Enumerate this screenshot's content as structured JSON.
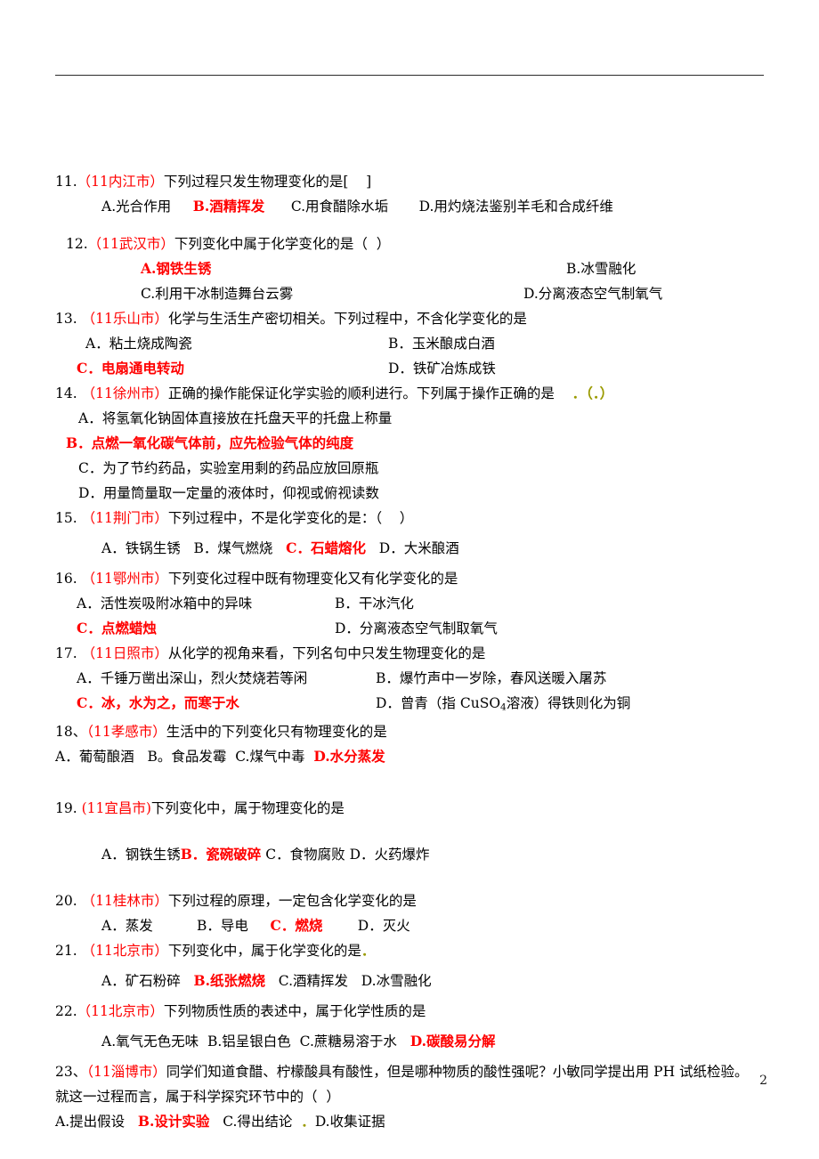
{
  "document": {
    "page_number": "2",
    "accent_red": "#ff0000",
    "marker_olive": "#9a9a00"
  },
  "questions": [
    {
      "id": "q11",
      "number": "11.",
      "source": "（11内江市）",
      "stem": "下列过程只发生物理变化的是[    ]",
      "options_line": {
        "a": "A.光合作用",
        "b": "B.酒精挥发",
        "c": "C.用食醋除水垢",
        "d": "D.用灼烧法鉴别羊毛和合成纤维"
      },
      "answer": "B"
    },
    {
      "id": "q12",
      "number": "12.",
      "source": "（11武汉市）",
      "stem": "下列变化中属于化学变化的是（  ）",
      "options": {
        "a": "A.钢铁生锈",
        "b": "B.冰雪融化",
        "c": "C.利用干冰制造舞台云雾",
        "d": "D.分离液态空气制氧气"
      },
      "answer": "A"
    },
    {
      "id": "q13",
      "number": "13.",
      "source": "（11乐山市）",
      "stem": "化学与生活生产密切相关。下列过程中，不含化学变化的是",
      "options": {
        "a": "A．粘土烧成陶瓷",
        "b": "B．玉米酿成白酒",
        "c": "C．电扇通电转动",
        "d": "D．铁矿冶炼成铁"
      },
      "answer": "C"
    },
    {
      "id": "q14",
      "number": "14.",
      "source": "（11徐州市）",
      "stem": "正确的操作能保证化学实验的顺利进行。下列属于操作正确的是",
      "stem_marks": "．（．）",
      "options": {
        "a": "A．将氢氧化钠固体直接放在托盘天平的托盘上称量",
        "b": "B．点燃一氧化碳气体前，应先检验气体的纯度",
        "c": "C．为了节约药品，实验室用剩的药品应放回原瓶",
        "d": "D．用量筒量取一定量的液体时，仰视或俯视读数"
      },
      "answer": "B"
    },
    {
      "id": "q15",
      "number": "15.",
      "source": "（11荆门市）",
      "stem": "下列过程中，不是化学变化的是：（    ）",
      "options_line": {
        "a": "A．铁锅生锈",
        "b": "B．煤气燃烧",
        "c": "C．石蜡熔化",
        "d": "D．大米酿酒"
      },
      "answer": "C"
    },
    {
      "id": "q16",
      "number": "16.",
      "source": "（11鄂州市）",
      "stem": "下列变化过程中既有物理变化又有化学变化的是",
      "options": {
        "a": "A．活性炭吸附冰箱中的异味",
        "b": "B．干冰汽化",
        "c": "C．点燃蜡烛",
        "d": "D．分离液态空气制取氧气"
      },
      "answer": "C"
    },
    {
      "id": "q17",
      "number": "17.",
      "source": "（11日照市）",
      "stem": "从化学的视角来看，下列名句中只发生物理变化的是",
      "options": {
        "a": "A．千锤万凿出深山，烈火焚烧若等闲",
        "b": "B．爆竹声中一岁除，春风送暖入屠苏",
        "c": "C．冰，水为之，而寒于水",
        "d_pre": "D．曾青（指 CuSO",
        "d_sub": "4",
        "d_post": "溶液）得铁则化为铜"
      },
      "answer": "C"
    },
    {
      "id": "q18",
      "number": "18、",
      "source": "（11孝感市）",
      "stem": "生活中的下列变化只有物理变化的是",
      "options_line": {
        "a": "A．葡萄酿酒",
        "b": "B。食品发霉",
        "c": "C.煤气中毒",
        "d": "D.水分蒸发"
      },
      "answer": "D"
    },
    {
      "id": "q19",
      "number": "19.",
      "source": "(11宜昌市)",
      "stem": "下列变化中，属于物理变化的是",
      "options_line": {
        "a": "A．钢铁生锈",
        "b": "B．瓷碗破碎",
        "c": "C．食物腐败",
        "d": "D．火药爆炸"
      },
      "answer": "B"
    },
    {
      "id": "q20",
      "number": "20.",
      "source": "（11桂林市）",
      "stem": "下列过程的原理，一定包含化学变化的是",
      "options_line": {
        "a": "A．蒸发",
        "b": "B．导电",
        "c": "C．燃烧",
        "d": "D．灭火"
      },
      "answer": "C"
    },
    {
      "id": "q21",
      "number": "21.",
      "source": "（11北京市）",
      "stem": "下列变化中，属于化学变化的是",
      "stem_marks": "．",
      "options_line": {
        "a": "A．矿石粉碎",
        "b": "B.纸张燃烧",
        "c": "C.酒精挥发",
        "d": "D.冰雪融化"
      },
      "answer": "B"
    },
    {
      "id": "q22",
      "number": "22.",
      "source": "（11北京市）",
      "stem": "下列物质性质的表述中，属于化学性质的是",
      "options_line": {
        "a": "A.氧气无色无味",
        "b": "B.铝呈银白色",
        "c": "C.蔗糖易溶于水",
        "d": "D.碳酸易分解"
      },
      "answer": "D"
    },
    {
      "id": "q23",
      "number": "23、",
      "source": "（11淄博市）",
      "stem_line1": "同学们知道食醋、柠檬酸具有酸性，但是哪种物质的酸性强呢？小敏同学提出用 PH 试纸检验。",
      "stem_line2": "就这一过程而言，属于科学探究环节中的（  ）",
      "stem_line2_mark": "．",
      "options_line": {
        "a": "A.提出假设",
        "b": "B.设计实验",
        "c": "C.得出结论",
        "d": "D.收集证据",
        "mark": "．"
      },
      "answer": "B"
    }
  ]
}
